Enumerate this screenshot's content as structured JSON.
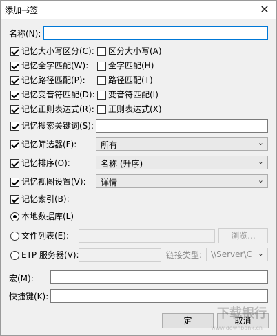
{
  "window": {
    "title": "添加书签",
    "close_icon": "close-icon"
  },
  "name": {
    "label": "名称(N):",
    "value": ""
  },
  "rows": [
    {
      "label": "记忆大小写区分(C):",
      "checked": true,
      "opt_label": "区分大小写(A)",
      "opt_checked": false
    },
    {
      "label": "记忆全字匹配(W):",
      "checked": true,
      "opt_label": "全字匹配(H)",
      "opt_checked": false
    },
    {
      "label": "记忆路径匹配(P):",
      "checked": true,
      "opt_label": "路径匹配(T)",
      "opt_checked": false
    },
    {
      "label": "记忆变音符匹配(D):",
      "checked": true,
      "opt_label": "变音符匹配(I)",
      "opt_checked": false
    },
    {
      "label": "记忆正则表达式(R):",
      "checked": true,
      "opt_label": "正则表达式(X)",
      "opt_checked": false
    }
  ],
  "search": {
    "label": "记忆搜索关键词(S):",
    "checked": true,
    "value": ""
  },
  "filter": {
    "label": "记忆筛选器(F):",
    "checked": true,
    "value": "所有"
  },
  "sort": {
    "label": "记忆排序(O):",
    "checked": true,
    "value": "名称 (升序)"
  },
  "view": {
    "label": "记忆视图设置(V):",
    "checked": true,
    "value": "详情"
  },
  "index": {
    "label": "记忆索引(B):",
    "checked": true
  },
  "local_db": {
    "label": "本地数据库(L)",
    "selected": true
  },
  "file_list": {
    "label": "文件列表(E):",
    "selected": false,
    "value": "",
    "browse": "浏览..."
  },
  "etp": {
    "label": "ETP 服务器(V):",
    "selected": false,
    "value": "",
    "link_type_label": "链接类型:",
    "link_type_value": "\\\\Server\\C"
  },
  "macro": {
    "label": "宏(M):",
    "value": ""
  },
  "hotkey": {
    "label": "快捷键(K):",
    "value": ""
  },
  "buttons": {
    "ok": "定",
    "cancel": "取消"
  },
  "watermark": {
    "text": "下载银行",
    "sub": "www.downbank.cn"
  }
}
